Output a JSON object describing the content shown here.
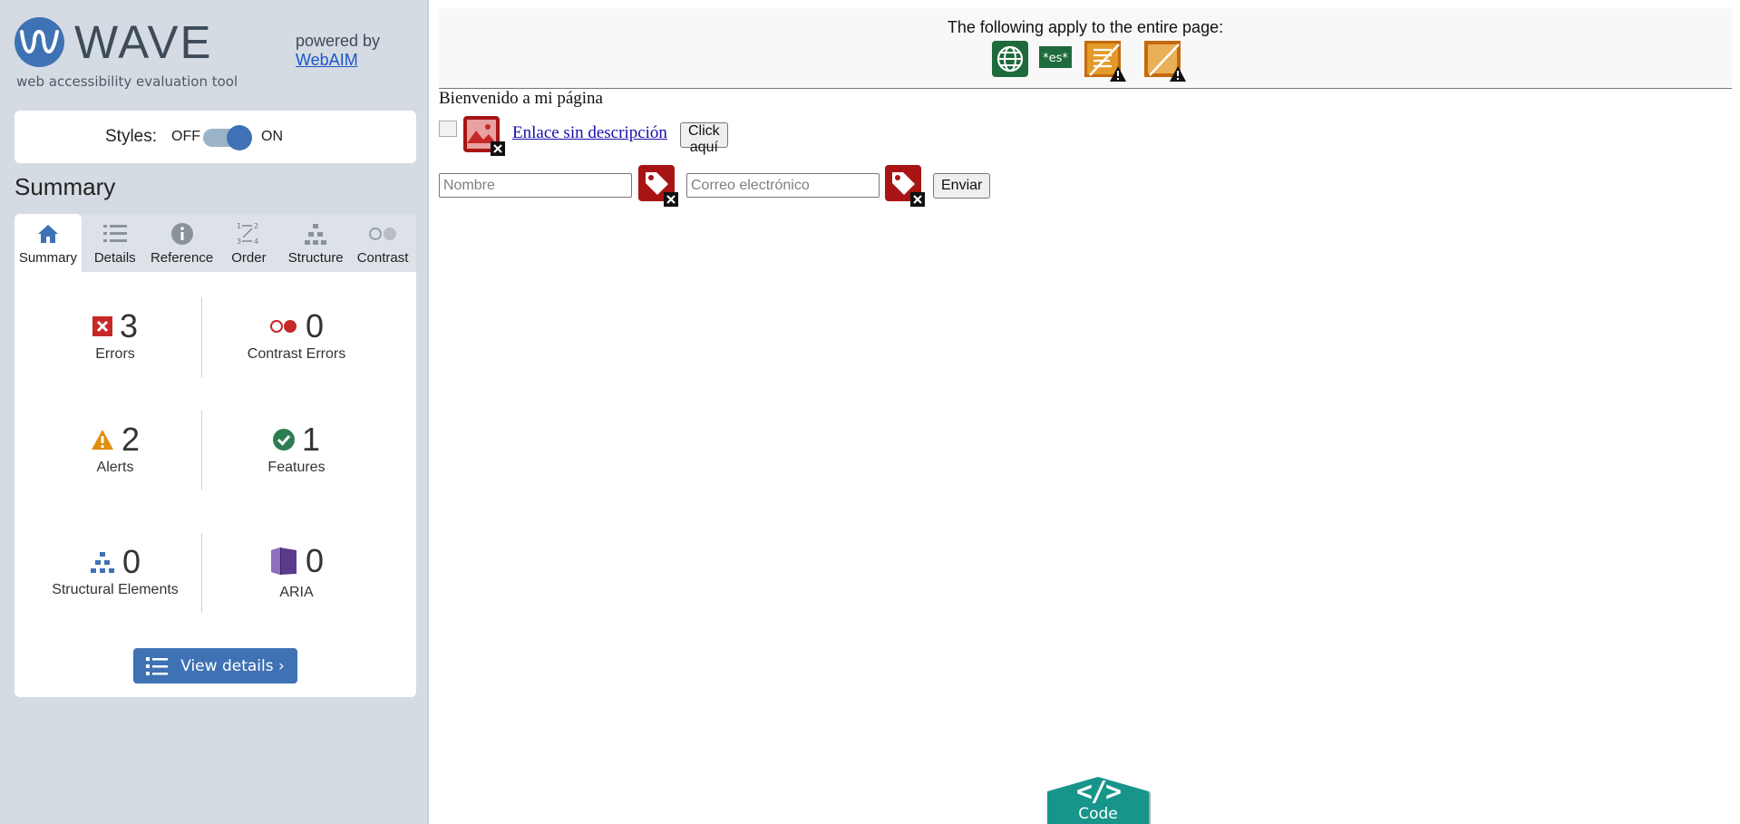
{
  "app": {
    "brand": "WAVE",
    "tagline": "web accessibility evaluation tool",
    "powered_by": "powered by",
    "powered_link": "WebAIM"
  },
  "styles_toggle": {
    "label": "Styles:",
    "off": "OFF",
    "on": "ON",
    "state": "on"
  },
  "summary_title": "Summary",
  "tabs": [
    {
      "label": "Summary",
      "icon": "home-icon",
      "active": true
    },
    {
      "label": "Details",
      "icon": "list-icon"
    },
    {
      "label": "Reference",
      "icon": "info-icon"
    },
    {
      "label": "Order",
      "icon": "order-icon"
    },
    {
      "label": "Structure",
      "icon": "structure-icon"
    },
    {
      "label": "Contrast",
      "icon": "contrast-icon"
    }
  ],
  "stats": {
    "errors": {
      "count": "3",
      "label": "Errors"
    },
    "contrast": {
      "count": "0",
      "label": "Contrast Errors"
    },
    "alerts": {
      "count": "2",
      "label": "Alerts"
    },
    "features": {
      "count": "1",
      "label": "Features"
    },
    "structural": {
      "count": "0",
      "label": "Structural Elements"
    },
    "aria": {
      "count": "0",
      "label": "ARIA"
    }
  },
  "view_details": "View details ›",
  "page": {
    "banner_text": "The following apply to the entire page:",
    "lang_badge": "*es*",
    "heading": "Bienvenido a mi página",
    "link_text": "Enlace sin descripción",
    "click_button": "Click aquí",
    "name_placeholder": "Nombre",
    "email_placeholder": "Correo electrónico",
    "send_button": "Enviar"
  },
  "code_tab": {
    "label": "Code",
    "glyph": "</>"
  },
  "colors": {
    "brand_blue": "#3f72b4",
    "error_red": "#b81c1c",
    "alert_orange": "#d98b0b",
    "feature_green": "#2e7d52",
    "aria_purple": "#5b3b8c",
    "code_teal": "#17958a"
  }
}
